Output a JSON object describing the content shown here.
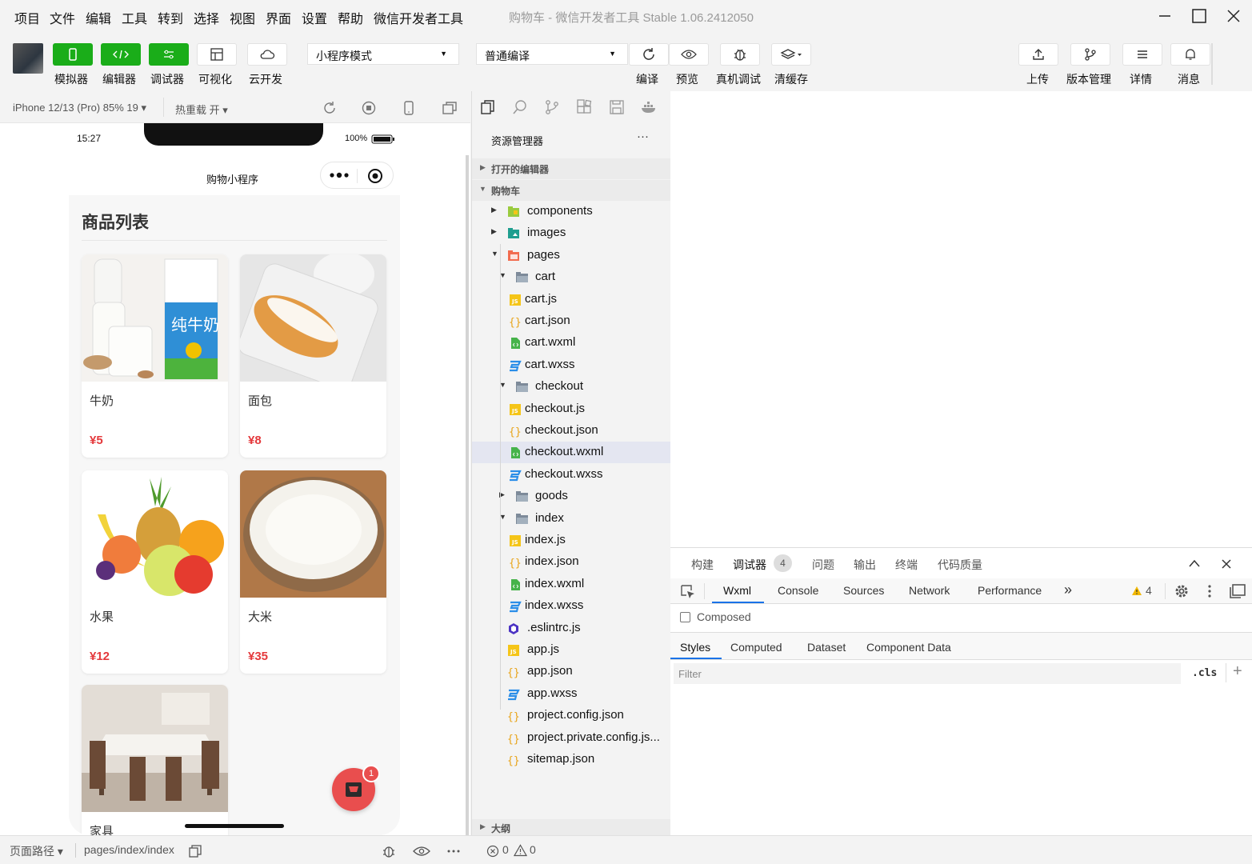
{
  "menubar": {
    "items": [
      "项目",
      "文件",
      "编辑",
      "工具",
      "转到",
      "选择",
      "视图",
      "界面",
      "设置",
      "帮助",
      "微信开发者工具"
    ],
    "title": "购物车 - 微信开发者工具 Stable 1.06.2412050"
  },
  "toolbar": {
    "left_buttons": [
      "模拟器",
      "编辑器",
      "调试器",
      "可视化",
      "云开发"
    ],
    "mode_select": "小程序模式",
    "compile_select": "普通编译",
    "mid_buttons": [
      "编译",
      "预览",
      "真机调试",
      "清缓存"
    ],
    "right_buttons": [
      "上传",
      "版本管理",
      "详情",
      "消息"
    ]
  },
  "simulator": {
    "device": "iPhone 12/13 (Pro) 85% 19",
    "hot_reload": "热重载 开",
    "status_time": "15:27",
    "battery": "100%",
    "nav_title": "购物小程序",
    "page_heading": "商品列表",
    "cart_badge": "1",
    "products": [
      {
        "name": "牛奶",
        "price": "¥5"
      },
      {
        "name": "面包",
        "price": "¥8"
      },
      {
        "name": "水果",
        "price": "¥12"
      },
      {
        "name": "大米",
        "price": "¥35"
      },
      {
        "name": "家具",
        "price": ""
      }
    ]
  },
  "explorer": {
    "title": "资源管理器",
    "more": "···",
    "open_editors": "打开的编辑器",
    "project": "购物车",
    "outline": "大纲",
    "tree": [
      {
        "label": "components",
        "icon": "folder-components",
        "arrow": "right"
      },
      {
        "label": "images",
        "icon": "folder-images",
        "arrow": "right"
      },
      {
        "label": "pages",
        "icon": "folder-pages",
        "arrow": "down"
      },
      {
        "label": "cart",
        "icon": "folder",
        "arrow": "down"
      },
      {
        "label": "cart.js",
        "icon": "js"
      },
      {
        "label": "cart.json",
        "icon": "json"
      },
      {
        "label": "cart.wxml",
        "icon": "wxml"
      },
      {
        "label": "cart.wxss",
        "icon": "wxss"
      },
      {
        "label": "checkout",
        "icon": "folder",
        "arrow": "down"
      },
      {
        "label": "checkout.js",
        "icon": "js"
      },
      {
        "label": "checkout.json",
        "icon": "json"
      },
      {
        "label": "checkout.wxml",
        "icon": "wxml",
        "selected": true
      },
      {
        "label": "checkout.wxss",
        "icon": "wxss"
      },
      {
        "label": "goods",
        "icon": "folder",
        "arrow": "right"
      },
      {
        "label": "index",
        "icon": "folder",
        "arrow": "down"
      },
      {
        "label": "index.js",
        "icon": "js"
      },
      {
        "label": "index.json",
        "icon": "json"
      },
      {
        "label": "index.wxml",
        "icon": "wxml"
      },
      {
        "label": "index.wxss",
        "icon": "wxss"
      },
      {
        "label": ".eslintrc.js",
        "icon": "eslint"
      },
      {
        "label": "app.js",
        "icon": "js"
      },
      {
        "label": "app.json",
        "icon": "json"
      },
      {
        "label": "app.wxss",
        "icon": "wxss"
      },
      {
        "label": "project.config.json",
        "icon": "json"
      },
      {
        "label": "project.private.config.js...",
        "icon": "json"
      },
      {
        "label": "sitemap.json",
        "icon": "json"
      }
    ]
  },
  "devtools": {
    "top_tabs": [
      "构建",
      "调试器",
      "问题",
      "输出",
      "终端",
      "代码质量"
    ],
    "debugger_count": "4",
    "panel_tabs": [
      "Wxml",
      "Console",
      "Sources",
      "Network",
      "Performance"
    ],
    "more_tabs": "»",
    "warning_count": "4",
    "composed": "Composed",
    "sub_tabs": [
      "Styles",
      "Computed",
      "Dataset",
      "Component Data"
    ],
    "filter_placeholder": "Filter",
    "cls": ".cls",
    "plus": "+"
  },
  "statusbar": {
    "page_path_label": "页面路径",
    "page_path": "pages/index/index",
    "errors": "0",
    "warnings": "0"
  },
  "colors": {
    "green": "#1aad19",
    "price_red": "#e4393c",
    "selected_row": "#e4e6f1",
    "tab_underline": "#1a73e8"
  }
}
